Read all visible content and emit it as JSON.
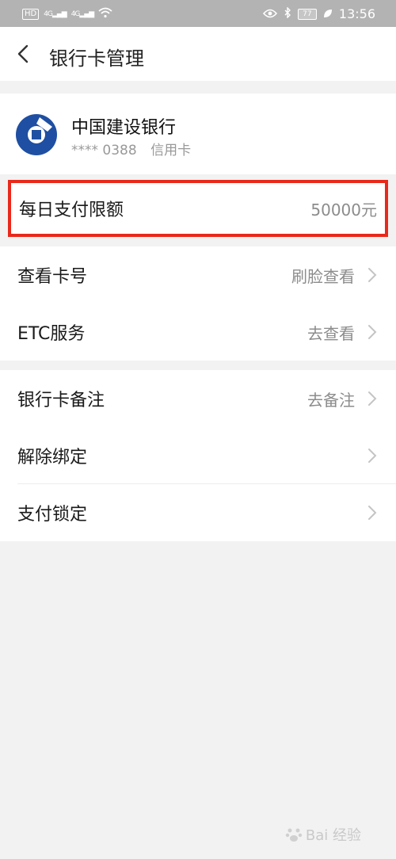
{
  "status_bar": {
    "hd": "HD",
    "signal1": "4G",
    "signal2": "4G",
    "battery": "77",
    "time": "13:56",
    "icons": [
      "hd-icon",
      "signal-icon",
      "wifi-icon",
      "eye-icon",
      "bluetooth-icon",
      "battery-icon",
      "leaf-icon"
    ]
  },
  "header": {
    "title": "银行卡管理"
  },
  "card": {
    "bank_name": "中国建设银行",
    "card_number": "**** 0388",
    "card_type": "信用卡",
    "logo_color": "#1f4fa2"
  },
  "limit_row": {
    "label": "每日支付限额",
    "value": "50000元"
  },
  "section1": [
    {
      "label": "查看卡号",
      "value": "刷脸查看"
    },
    {
      "label": "ETC服务",
      "value": "去查看"
    }
  ],
  "section2": [
    {
      "label": "银行卡备注",
      "value": "去备注"
    },
    {
      "label": "解除绑定",
      "value": ""
    },
    {
      "label": "支付锁定",
      "value": ""
    }
  ],
  "watermark": "Bai 经验",
  "colors": {
    "highlight": "#e8291c",
    "background": "#f2f2f2"
  }
}
